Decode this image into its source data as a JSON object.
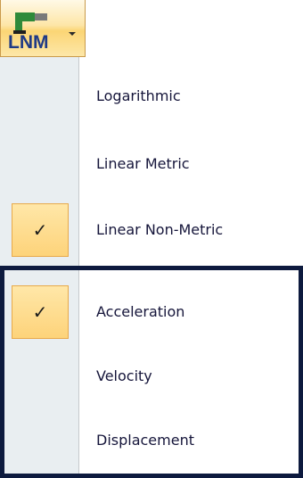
{
  "ribbon_button": {
    "label": "LNM",
    "icon": "units-icon",
    "dropdown_icon": "chevron-down-icon"
  },
  "menu": {
    "items": [
      {
        "label": "Logarithmic",
        "checked": false
      },
      {
        "label": "Linear Metric",
        "checked": false
      },
      {
        "label": "Linear Non-Metric",
        "checked": true
      },
      {
        "label": "Acceleration",
        "checked": true
      },
      {
        "label": "Velocity",
        "checked": false
      },
      {
        "label": "Displacement",
        "checked": false
      }
    ],
    "check_glyph": "✓"
  },
  "colors": {
    "highlight": "#fdd37a",
    "group_border": "#0d1a3e",
    "gutter": "#e9eef1"
  }
}
